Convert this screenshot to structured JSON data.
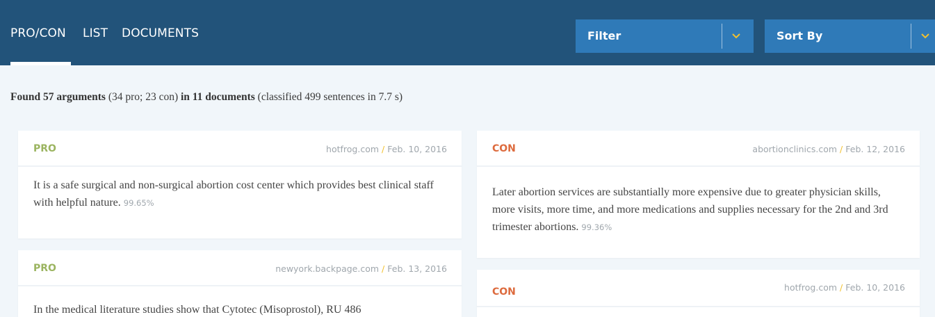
{
  "nav": {
    "tabs": [
      {
        "label": "PRO/CON",
        "active": true
      },
      {
        "label": "LIST",
        "active": false
      },
      {
        "label": "DOCUMENTS",
        "active": false
      }
    ]
  },
  "filter": {
    "label": "Filter",
    "icon": "chevron-down-icon"
  },
  "sort": {
    "label": "Sort By",
    "icon": "chevron-down-icon"
  },
  "summary": {
    "found": "Found 57 arguments",
    "counts": "(34 pro; 23 con)",
    "docs": "in 11 documents",
    "classified": "(classified 499 sentences in 7.7 s)"
  },
  "cards": [
    {
      "stance": "PRO",
      "source": "hotfrog.com",
      "date": "Feb. 10, 2016",
      "text": "It is a safe surgical and non-surgical abortion cost center which provides best clinical staff with helpful nature.",
      "confidence": "99.65%"
    },
    {
      "stance": "PRO",
      "source": "newyork.backpage.com",
      "date": "Feb. 13, 2016",
      "text": "In the medical literature studies show that Cytotec (Misoprostol), RU 486"
    },
    {
      "stance": "CON",
      "source": "abortionclinics.com",
      "date": "Feb. 12, 2016",
      "text": "Later abortion services are substantially more expensive due to greater physician skills, more visits, more time, and more medications and supplies necessary for the 2nd and 3rd trimester abortions.",
      "confidence": "99.36%"
    },
    {
      "stance": "CON",
      "source": "hotfrog.com",
      "date": "Feb. 10, 2016"
    }
  ],
  "colors": {
    "header": "#22537a",
    "dropdown": "#2f7ab8",
    "accent": "#f2c12e",
    "pro": "#9bb460",
    "con": "#dd6b3e"
  }
}
